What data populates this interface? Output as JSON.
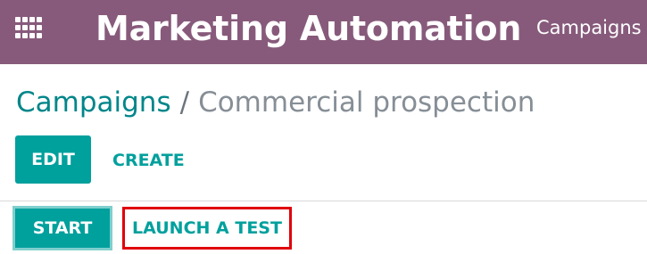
{
  "navbar": {
    "app_title": "Marketing Automation",
    "menu_campaigns": "Campaigns",
    "apps_icon": "apps-grid-icon",
    "bg_color": "#875a7b"
  },
  "breadcrumb": {
    "parent": "Campaigns",
    "separator": "/",
    "current": "Commercial prospection"
  },
  "control_panel": {
    "edit_label": "EDIT",
    "create_label": "CREATE"
  },
  "statusbar": {
    "start_label": "START",
    "launch_test_label": "LAUNCH A TEST",
    "highlight_color": "#e0000a"
  },
  "colors": {
    "primary": "#00a09d",
    "link": "#00868a"
  }
}
